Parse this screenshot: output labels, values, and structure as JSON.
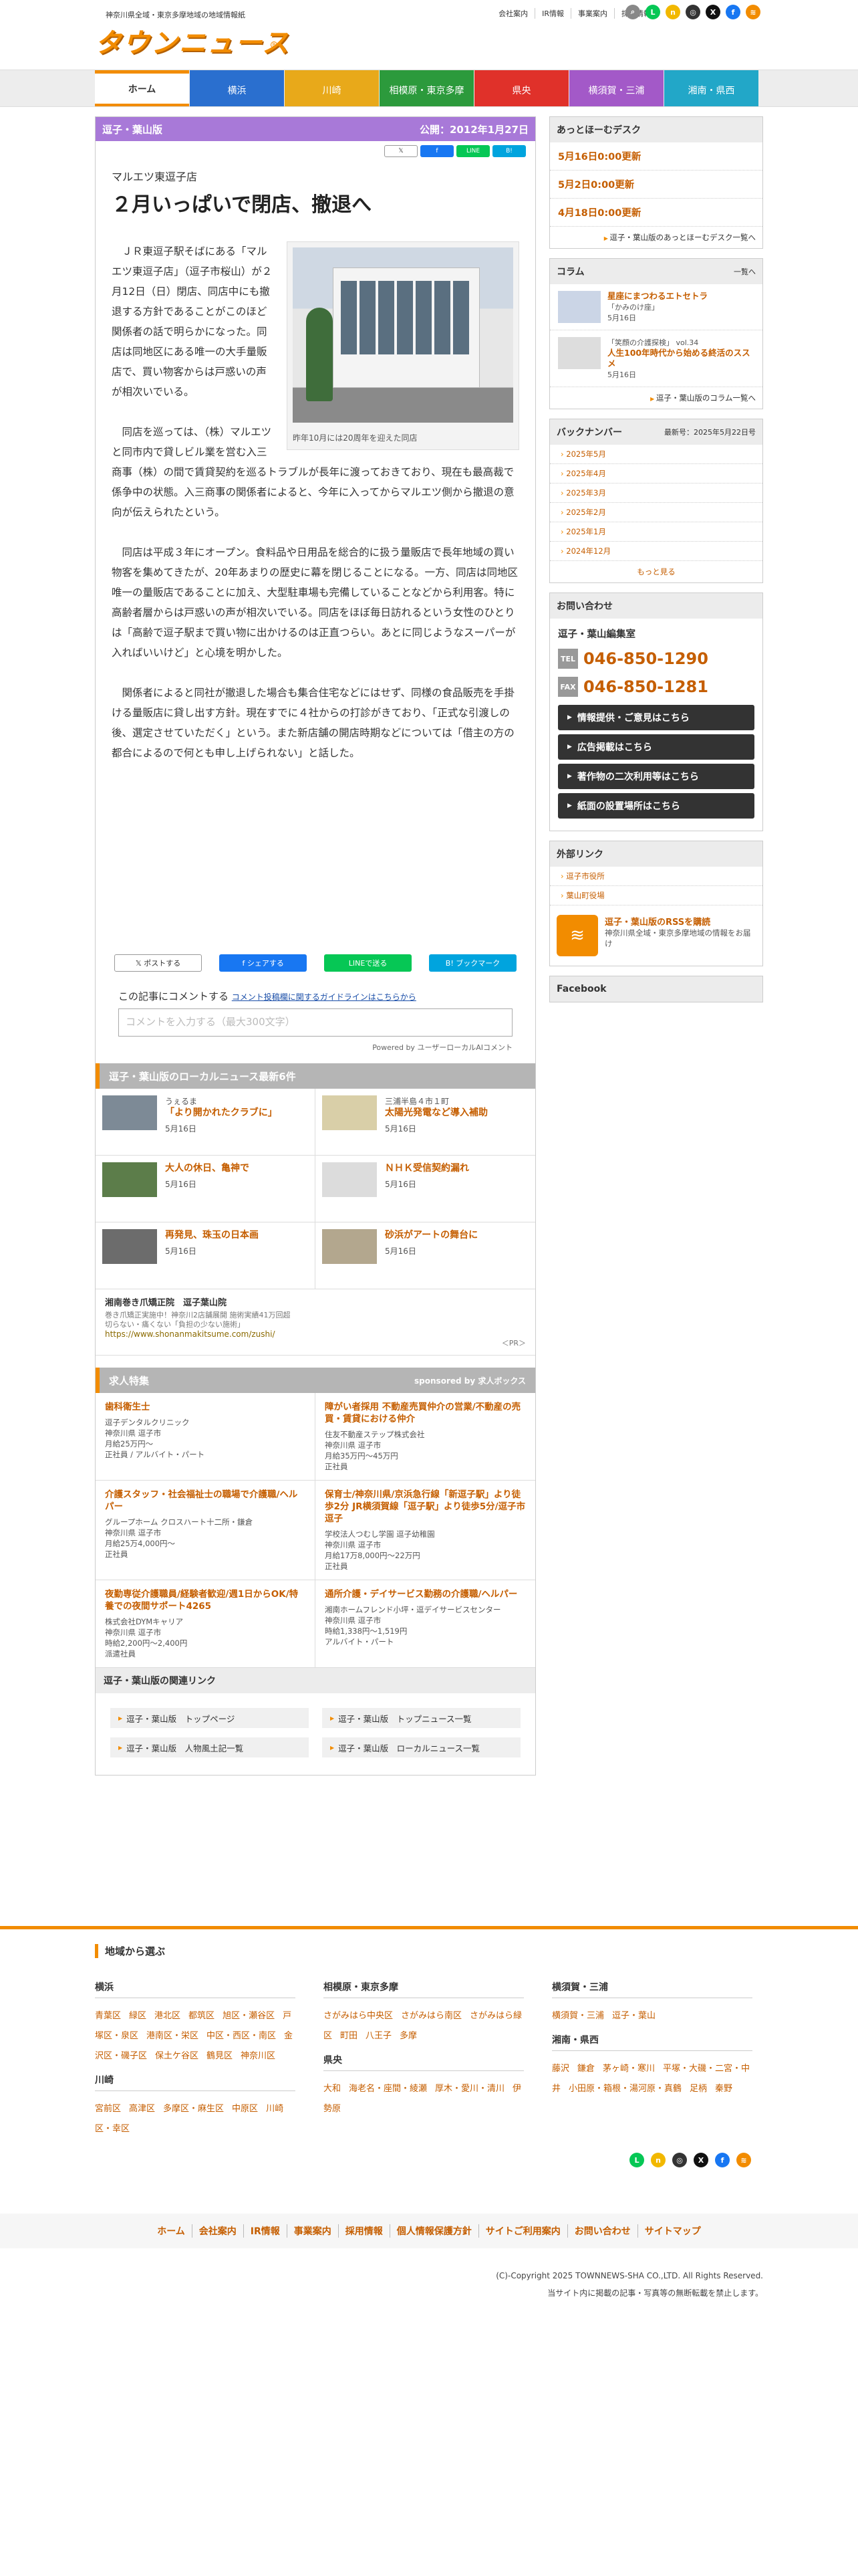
{
  "header": {
    "tagline": "神奈川県全域・東京多摩地域の地域情報紙",
    "logo": "タウンニュース",
    "logo_mark": "R",
    "top_links": [
      "会社案内",
      "IR情報",
      "事業案内",
      "採用情報"
    ],
    "icons": [
      {
        "name": "search-icon",
        "glyph": "⌕",
        "color": "#888888"
      },
      {
        "name": "line-icon",
        "glyph": "L",
        "color": "#06c755"
      },
      {
        "name": "note-icon",
        "glyph": "n",
        "color": "#f2b800"
      },
      {
        "name": "instagram-icon",
        "glyph": "◎",
        "color": "#333333"
      },
      {
        "name": "x-icon",
        "glyph": "X",
        "color": "#111111"
      },
      {
        "name": "facebook-icon",
        "glyph": "f",
        "color": "#1877f2"
      },
      {
        "name": "rss-icon",
        "glyph": "≋",
        "color": "#f28c00"
      }
    ]
  },
  "nav": [
    {
      "label": "ホーム",
      "color": "#ffffff"
    },
    {
      "label": "横浜",
      "color": "#2a6fcf"
    },
    {
      "label": "川崎",
      "color": "#e8a91a"
    },
    {
      "label": "相模原・東京多摩",
      "color": "#2c9a3c"
    },
    {
      "label": "県央",
      "color": "#e0312a"
    },
    {
      "label": "横須賀・三浦",
      "color": "#a359c8"
    },
    {
      "label": "湘南・県西",
      "color": "#22a7c8"
    }
  ],
  "article": {
    "edition": "逗子・葉山版",
    "published": "公開：2012年1月27日",
    "share_small": [
      "𝕏",
      "f",
      "LINE",
      "B!"
    ],
    "subtitle": "マルエツ東逗子店",
    "title": "２月いっぱいで閉店、撤退へ",
    "photo_caption": "昨年10月には20周年を迎えた同店",
    "paragraphs": [
      "ＪＲ東逗子駅そばにある「マルエツ東逗子店」（逗子市桜山）が２月12日（日）閉店、同店中にも撤退する方針であることがこのほど関係者の話で明らかになった。同店は同地区にある唯一の大手量販店で、買い物客からは戸惑いの声が相次いでいる。",
      "同店を巡っては、（株）マルエツと同市内で貸しビル業を営む入三商事（株）の間で賃貸契約を巡るトラブルが長年に渡っておきており、現在も最高裁で係争中の状態。入三商事の関係者によると、今年に入ってからマルエツ側から撤退の意向が伝えられたという。",
      "同店は平成３年にオープン。食料品や日用品を総合的に扱う量販店で長年地域の買い物客を集めてきたが、20年あまりの歴史に幕を閉じることになる。一方、同店は同地区唯一の量販店であることに加え、大型駐車場も完備していることなどから利用客。特に高齢者層からは戸惑いの声が相次いでいる。同店をほぼ毎日訪れるという女性のひとりは「高齢で逗子駅まで買い物に出かけるのは正直つらい。あとに同じようなスーパーが入ればいいけど」と心境を明かした。",
      "関係者によると同社が撤退した場合も集合住宅などにはせず、同様の食品販売を手掛ける量販店に貸し出す方針。現在すでに４社からの打診がきており、「正式な引渡しの後、選定させていただく」という。また新店舗の開店時期などについては「借主の方の都合によるので何とも申し上げられない」と話した。"
    ],
    "share_big": [
      {
        "label": "𝕏  ポストする",
        "color": "#ffffff",
        "text": "#333333"
      },
      {
        "label": "f  シェアする",
        "color": "#1877f2",
        "text": "#ffffff"
      },
      {
        "label": "LINEで送る",
        "color": "#06c755",
        "text": "#ffffff"
      },
      {
        "label": "B! ブックマーク",
        "color": "#00a4de",
        "text": "#ffffff"
      }
    ],
    "comment_label": "この記事にコメントする",
    "comment_guide": "コメント投稿欄に関するガイドラインはこちらから",
    "comment_placeholder": "コメントを入力する（最大300文字）",
    "powered": "Powered by ユーザーローカルAIコメント"
  },
  "local_news": {
    "heading": "逗子・葉山版のローカルニュース最新6件",
    "items": [
      {
        "pre": "うぇるま",
        "title": "「より開かれたクラブに」",
        "date": "5月16日"
      },
      {
        "pre": "三浦半島４市１町",
        "title": "太陽光発電など導入補助",
        "date": "5月16日"
      },
      {
        "pre": "",
        "title": "大人の休日、亀神で",
        "date": "5月16日"
      },
      {
        "pre": "",
        "title": "ＮＨＫ受信契約漏れ",
        "date": "5月16日"
      },
      {
        "pre": "",
        "title": "再発見、珠玉の日本画",
        "date": "5月16日"
      },
      {
        "pre": "",
        "title": "砂浜がアートの舞台に",
        "date": "5月16日"
      }
    ],
    "ad_title": "湘南巻き爪矯正院　逗子葉山院",
    "ad_desc1": "巻き爪矯正実施中！神奈川2店舗展開 施術実績41万回超",
    "ad_desc2": "切らない・痛くない「負担の少ない施術」",
    "ad_url": "https://www.shonanmakitsume.com/zushi/",
    "ad_pr": "＜PR＞"
  },
  "jobs": {
    "heading": "求人特集",
    "sponsor": "sponsored by 求人ボックス",
    "items": [
      {
        "title": "歯科衛生士",
        "company": "逗子デンタルクリニック",
        "lines": [
          "神奈川県 逗子市",
          "月給25万円〜",
          "正社員 / アルバイト・パート"
        ]
      },
      {
        "title": "障がい者採用 不動産売買仲介の営業/不動産の売買・賃貸における仲介",
        "company": "住友不動産ステップ株式会社",
        "lines": [
          "神奈川県 逗子市",
          "月給35万円〜45万円",
          "正社員"
        ]
      },
      {
        "title": "介護スタッフ・社会福祉士の職場で介護職/ヘルパー",
        "company": "グループホーム クロスハート十二所・鎌倉",
        "lines": [
          "神奈川県 逗子市",
          "月給25万4,000円〜",
          "正社員"
        ]
      },
      {
        "title": "保育士/神奈川県/京浜急行線「新逗子駅」より徒歩2分 JR横須賀線「逗子駅」より徒歩5分/逗子市逗子",
        "company": "学校法人つむし学園 逗子幼稚園",
        "lines": [
          "神奈川県 逗子市",
          "月給17万8,000円〜22万円",
          "正社員"
        ]
      },
      {
        "title": "夜勤専従介護職員/経験者歓迎/週1日からOK/特養での夜間サポート4265",
        "company": "株式会社DYMキャリア",
        "lines": [
          "神奈川県 逗子市",
          "時給2,200円〜2,400円",
          "派遣社員"
        ]
      },
      {
        "title": "通所介護・デイサービス勤務の介護職/ヘルパー",
        "company": "湘南ホームフレンド小坪・逗デイサービスセンター",
        "lines": [
          "神奈川県 逗子市",
          "時給1,338円〜1,519円",
          "アルバイト・パート"
        ]
      }
    ]
  },
  "related": {
    "heading": "逗子・葉山版の関連リンク",
    "links": [
      "逗子・葉山版　トップページ",
      "逗子・葉山版　トップニュース一覧",
      "逗子・葉山版　人物風土記一覧",
      "逗子・葉山版　ローカルニュース一覧"
    ]
  },
  "sidebar": {
    "desk_heading": "あっとほーむデスク",
    "desk_items": [
      "5月16日0:00更新",
      "5月2日0:00更新",
      "4月18日0:00更新"
    ],
    "desk_more": "逗子・葉山版のあっとほーむデスク一覧へ",
    "column_heading": "コラム",
    "column_more_head": "一覧へ",
    "columns": [
      {
        "pre": "",
        "title": "星座にまつわるエトセトラ",
        "sub": "「かみのけ座」",
        "date": "5月16日"
      },
      {
        "pre": "「笑顔の介護探検」 vol.34",
        "title": "人生100年時代から始める終活のススメ",
        "sub": "",
        "date": "5月16日"
      }
    ],
    "column_more": "逗子・葉山版のコラム一覧へ",
    "backnumber_heading": "バックナンバー",
    "backnumber_latest": "最新号：2025年5月22日号",
    "backnumbers": [
      "2025年5月",
      "2025年4月",
      "2025年3月",
      "2025年2月",
      "2025年1月",
      "2024年12月"
    ],
    "backnumber_more": "もっと見る",
    "contact_heading": "お問い合わせ",
    "contact_name": "逗子・葉山編集室",
    "tel_label": "TEL",
    "tel": "046-850-1290",
    "fax_label": "FAX",
    "fax": "046-850-1281",
    "buttons": [
      "情報提供・ご意見はこちら",
      "広告掲載はこちら",
      "著作物の二次利用等はこちら",
      "紙面の設置場所はこちら"
    ],
    "external_heading": "外部リンク",
    "external": [
      "逗子市役所",
      "葉山町役場"
    ],
    "rss_title": "逗子・葉山版のRSSを購読",
    "rss_desc": "神奈川県全域・東京多摩地域の情報をお届け",
    "facebook_heading": "Facebook"
  },
  "footer": {
    "region_heading": "地域から選ぶ",
    "yokohama": {
      "title": "横浜",
      "links": [
        "青葉区",
        "緑区",
        "港北区",
        "都筑区",
        "旭区・瀬谷区",
        "戸塚区・泉区",
        "港南区・栄区",
        "中区・西区・南区",
        "金沢区・磯子区",
        "保土ケ谷区",
        "鶴見区",
        "神奈川区"
      ]
    },
    "kawasaki": {
      "title": "川崎",
      "links": [
        "宮前区",
        "高津区",
        "多摩区・麻生区",
        "中原区",
        "川崎区・幸区"
      ]
    },
    "sagamihara": {
      "title": "相模原・東京多摩",
      "links": [
        "さがみはら中央区",
        "さがみはら南区",
        "さがみはら緑区",
        "町田",
        "八王子",
        "多摩"
      ]
    },
    "kenou": {
      "title": "県央",
      "links": [
        "大和",
        "海老名・座間・綾瀬",
        "厚木・愛川・清川",
        "伊勢原"
      ]
    },
    "yokosuka": {
      "title": "横須賀・三浦",
      "links": [
        "横須賀・三浦",
        "逗子・葉山"
      ]
    },
    "shonan": {
      "title": "湘南・県西",
      "links": [
        "藤沢",
        "鎌倉",
        "茅ヶ崎・寒川",
        "平塚・大磯・二宮・中井",
        "小田原・箱根・湯河原・真鶴",
        "足柄",
        "秦野"
      ]
    },
    "nav": [
      "ホーム",
      "会社案内",
      "IR情報",
      "事業案内",
      "採用情報",
      "個人情報保護方針",
      "サイトご利用案内",
      "お問い合わせ",
      "サイトマップ"
    ],
    "copyright": "(C)-Copyright 2025 TOWNNEWS-SHA CO.,LTD. All Rights Reserved.",
    "notice": "当サイト内に掲載の記事・写真等の無断転載を禁止します。"
  }
}
